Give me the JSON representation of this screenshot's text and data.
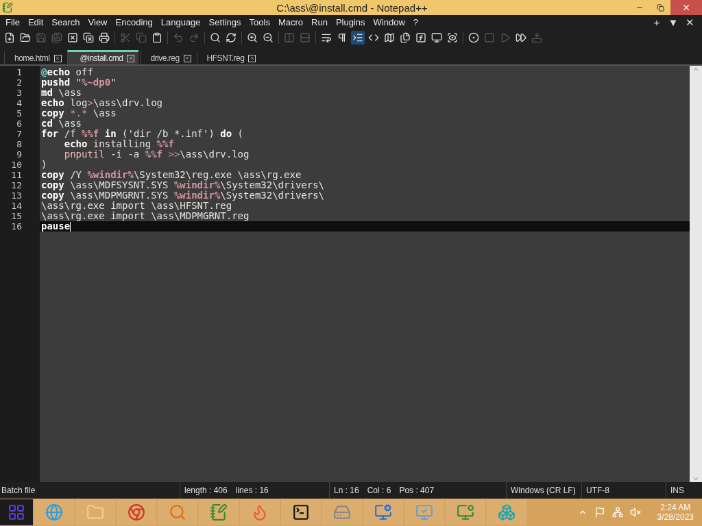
{
  "window": {
    "title": "C:\\ass\\@install.cmd - Notepad++"
  },
  "menu": [
    "File",
    "Edit",
    "Search",
    "View",
    "Encoding",
    "Language",
    "Settings",
    "Tools",
    "Macro",
    "Run",
    "Plugins",
    "Window",
    "?"
  ],
  "menu_right": [
    "+",
    "▼",
    "✕"
  ],
  "toolbar": [
    {
      "disabled": false
    },
    {
      "disabled": false
    },
    {
      "disabled": true
    },
    {
      "disabled": true
    },
    {
      "disabled": false
    },
    {
      "disabled": false
    },
    {
      "disabled": false
    },
    {
      "disabled": true
    },
    {
      "disabled": true
    },
    {
      "disabled": false
    },
    {
      "disabled": true
    },
    {
      "disabled": true
    },
    {
      "disabled": false
    },
    {
      "disabled": false
    },
    {
      "disabled": false
    },
    {
      "disabled": false
    },
    {
      "disabled": true
    },
    {
      "disabled": true
    },
    {
      "disabled": false
    },
    {
      "disabled": false
    },
    {
      "disabled": false,
      "selected": true
    },
    {
      "disabled": false
    },
    {
      "disabled": false
    },
    {
      "disabled": false
    },
    {
      "disabled": false
    },
    {
      "disabled": false
    },
    {
      "disabled": false
    },
    {
      "disabled": false
    },
    {
      "disabled": true
    },
    {
      "disabled": true
    },
    {
      "disabled": false
    },
    {
      "disabled": true
    }
  ],
  "tabs": [
    {
      "label": "home.html",
      "selected": false
    },
    {
      "label": "@install.cmd",
      "selected": true
    },
    {
      "label": "drive.reg",
      "selected": false
    },
    {
      "label": "HFSNT.reg",
      "selected": false
    }
  ],
  "editor": {
    "lines": [
      {
        "number": "1",
        "current": false,
        "tokens": [
          {
            "kind": "at",
            "text": "@"
          },
          {
            "kind": "kw",
            "text": "echo"
          },
          {
            "kind": "tx",
            "text": " off"
          }
        ]
      },
      {
        "number": "2",
        "current": false,
        "tokens": [
          {
            "kind": "kw",
            "text": "pushd"
          },
          {
            "kind": "tx",
            "text": " \""
          },
          {
            "kind": "var",
            "text": "%~dp0"
          },
          {
            "kind": "tx",
            "text": "\""
          }
        ]
      },
      {
        "number": "3",
        "current": false,
        "tokens": [
          {
            "kind": "kw",
            "text": "md"
          },
          {
            "kind": "tx",
            "text": " \\ass"
          }
        ]
      },
      {
        "number": "4",
        "current": false,
        "tokens": [
          {
            "kind": "kw",
            "text": "echo"
          },
          {
            "kind": "tx",
            "text": " log"
          },
          {
            "kind": "op",
            "text": ">"
          },
          {
            "kind": "tx",
            "text": "\\ass\\drv.log"
          }
        ]
      },
      {
        "number": "5",
        "current": false,
        "tokens": [
          {
            "kind": "kw",
            "text": "copy"
          },
          {
            "kind": "op",
            "text": " *.*"
          },
          {
            "kind": "tx",
            "text": " \\ass"
          }
        ]
      },
      {
        "number": "6",
        "current": false,
        "tokens": [
          {
            "kind": "kw",
            "text": "cd"
          },
          {
            "kind": "tx",
            "text": " \\ass"
          }
        ]
      },
      {
        "number": "7",
        "current": false,
        "tokens": [
          {
            "kind": "kw",
            "text": "for"
          },
          {
            "kind": "tx",
            "text": " /f "
          },
          {
            "kind": "var",
            "text": "%%f"
          },
          {
            "kind": "kw",
            "text": " in"
          },
          {
            "kind": "tx",
            "text": " ('dir /b *.inf') "
          },
          {
            "kind": "kw",
            "text": "do"
          },
          {
            "kind": "tx",
            "text": " ("
          }
        ]
      },
      {
        "number": "8",
        "current": false,
        "tokens": [
          {
            "kind": "kw",
            "text": "    echo"
          },
          {
            "kind": "tx",
            "text": " installing "
          },
          {
            "kind": "var",
            "text": "%%f"
          }
        ]
      },
      {
        "number": "9",
        "current": false,
        "tokens": [
          {
            "kind": "ext",
            "text": "    pnputil"
          },
          {
            "kind": "tx",
            "text": " -i -a "
          },
          {
            "kind": "var",
            "text": "%%f"
          },
          {
            "kind": "op",
            "text": " >>"
          },
          {
            "kind": "tx",
            "text": "\\ass\\drv.log"
          }
        ]
      },
      {
        "number": "10",
        "current": false,
        "tokens": [
          {
            "kind": "tx",
            "text": ")"
          }
        ]
      },
      {
        "number": "11",
        "current": false,
        "tokens": [
          {
            "kind": "kw",
            "text": "copy"
          },
          {
            "kind": "tx",
            "text": " /Y "
          },
          {
            "kind": "var",
            "text": "%windir%"
          },
          {
            "kind": "tx",
            "text": "\\System32\\reg.exe \\ass\\rg.exe"
          }
        ]
      },
      {
        "number": "12",
        "current": false,
        "tokens": [
          {
            "kind": "kw",
            "text": "copy"
          },
          {
            "kind": "tx",
            "text": " \\ass\\MDFSYSNT.SYS "
          },
          {
            "kind": "var",
            "text": "%windir%"
          },
          {
            "kind": "tx",
            "text": "\\System32\\drivers\\"
          }
        ]
      },
      {
        "number": "13",
        "current": false,
        "tokens": [
          {
            "kind": "kw",
            "text": "copy"
          },
          {
            "kind": "tx",
            "text": " \\ass\\MDPMGRNT.SYS "
          },
          {
            "kind": "var",
            "text": "%windir%"
          },
          {
            "kind": "tx",
            "text": "\\System32\\drivers\\"
          }
        ]
      },
      {
        "number": "14",
        "current": false,
        "tokens": [
          {
            "kind": "tx",
            "text": "\\ass\\rg.exe import \\ass\\HFSNT.reg"
          }
        ]
      },
      {
        "number": "15",
        "current": false,
        "tokens": [
          {
            "kind": "tx",
            "text": "\\ass\\rg.exe import \\ass\\MDPMGRNT.reg"
          }
        ]
      },
      {
        "number": "16",
        "current": true,
        "tokens": [
          {
            "kind": "kw",
            "text": "pause"
          }
        ]
      }
    ]
  },
  "status_bar": {
    "language": "Batch file",
    "length": "length : 406",
    "lines": "lines : 16",
    "ln": "Ln : 16",
    "col": "Col : 6",
    "pos": "Pos : 407",
    "eol": "Windows (CR LF)",
    "encoding": "UTF-8",
    "mode": "INS"
  },
  "taskbar": {
    "time": "2:24 AM",
    "date": "3/28/2023"
  }
}
